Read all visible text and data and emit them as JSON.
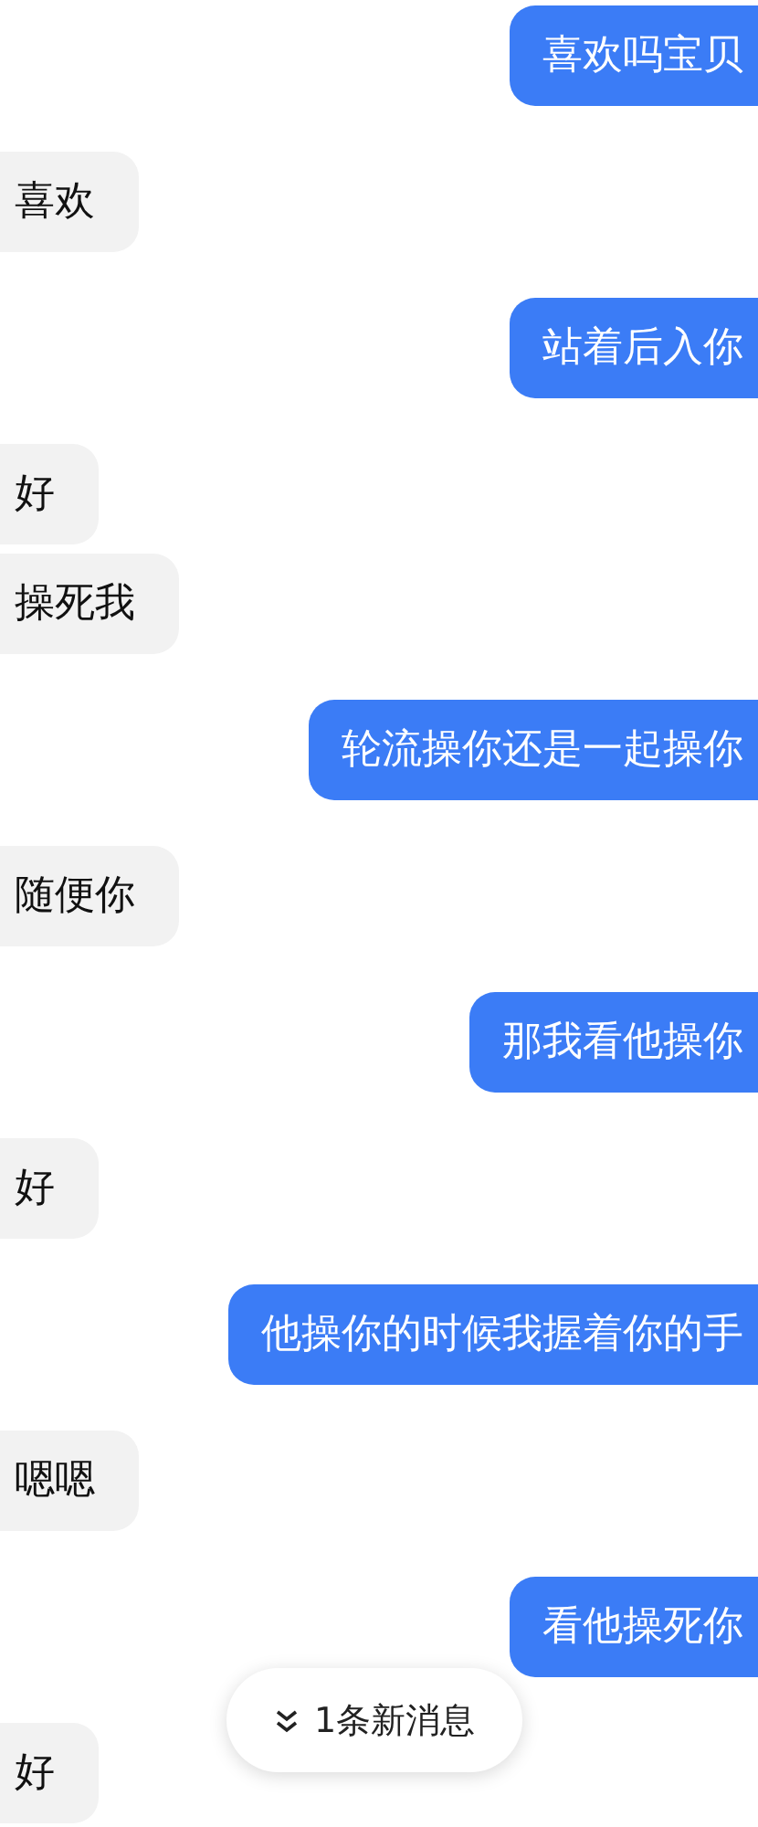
{
  "messages": [
    {
      "kind": "sent",
      "text": "喜欢吗宝贝"
    },
    {
      "kind": "received",
      "text": "喜欢"
    },
    {
      "kind": "sent",
      "text": "站着后入你"
    },
    {
      "kind": "received",
      "text": "好"
    },
    {
      "kind": "received",
      "text": "操死我"
    },
    {
      "kind": "sent",
      "text": "轮流操你还是一起操你"
    },
    {
      "kind": "received",
      "text": "随便你"
    },
    {
      "kind": "sent",
      "text": "那我看他操你"
    },
    {
      "kind": "received",
      "text": "好"
    },
    {
      "kind": "sent",
      "text": "他操你的时候我握着你的手"
    },
    {
      "kind": "received",
      "text": "嗯嗯"
    },
    {
      "kind": "sent",
      "text": "看他操死你"
    },
    {
      "kind": "received",
      "text": "好"
    }
  ],
  "new_messages_button": {
    "label": "1条新消息"
  }
}
